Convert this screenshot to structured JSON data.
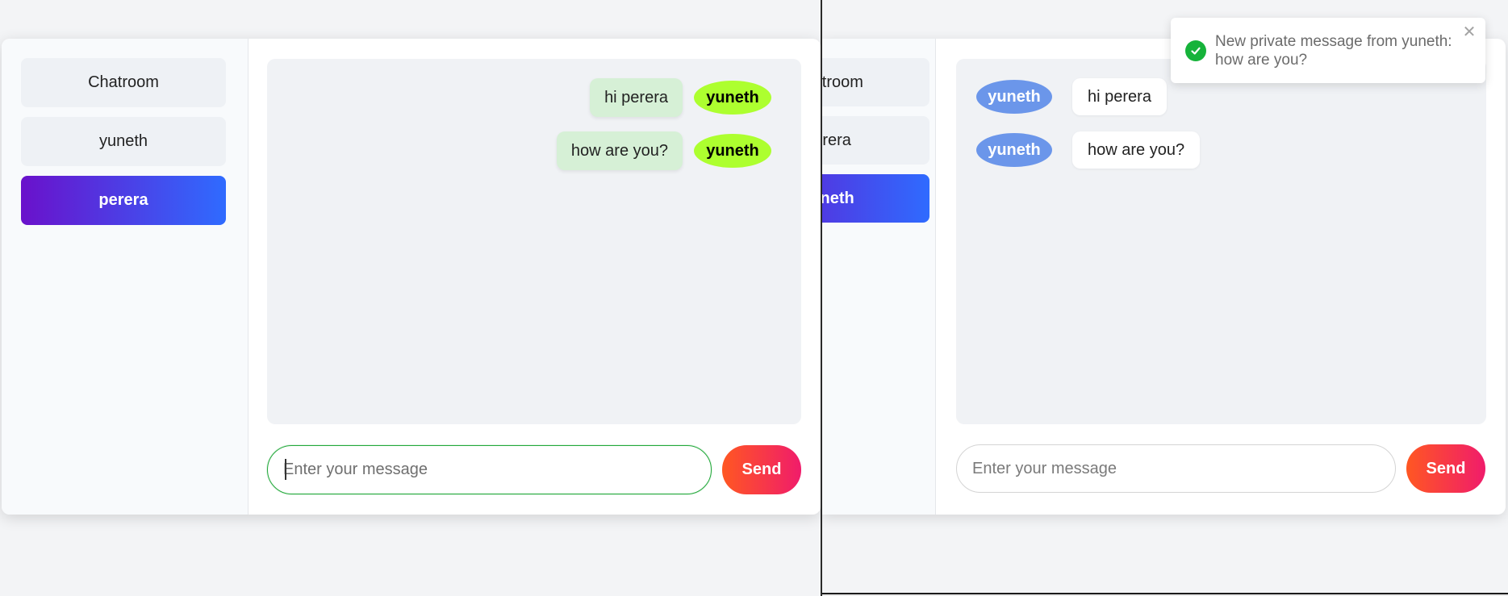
{
  "left_window": {
    "sidebar": {
      "items": [
        {
          "label": "Chatroom",
          "active": false
        },
        {
          "label": "yuneth",
          "active": false
        },
        {
          "label": "perera",
          "active": true
        }
      ]
    },
    "messages": [
      {
        "text": "hi perera",
        "sender": "yuneth"
      },
      {
        "text": "how are you?",
        "sender": "yuneth"
      }
    ],
    "input": {
      "value": "",
      "placeholder": "Enter your message"
    },
    "send_label": "Send"
  },
  "right_window": {
    "sidebar": {
      "items": [
        {
          "label": "Chatroom",
          "active": false
        },
        {
          "label": "perera",
          "active": false
        },
        {
          "label": "yuneth",
          "active": true
        }
      ]
    },
    "messages": [
      {
        "sender": "yuneth",
        "text": "hi perera"
      },
      {
        "sender": "yuneth",
        "text": "how are you?"
      }
    ],
    "input": {
      "value": "",
      "placeholder": "Enter your message"
    },
    "send_label": "Send"
  },
  "toast": {
    "message": "New private message from yuneth: how are you?",
    "icon": "check-circle-icon",
    "close_icon": "close-icon"
  },
  "colors": {
    "active_gradient_start": "#6a11cb",
    "active_gradient_end": "#2f6bff",
    "send_gradient_start": "#ff5722",
    "send_gradient_end": "#f01c6b",
    "own_sender_pill": "#adff2f",
    "other_sender_pill": "#6b96ea",
    "own_bubble": "#d6f0d6",
    "toast_success": "#16b33a"
  }
}
